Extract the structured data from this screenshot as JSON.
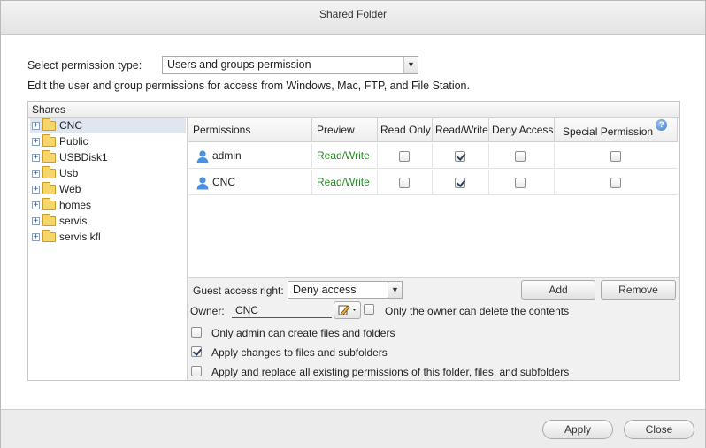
{
  "dialog": {
    "title": "Shared Folder"
  },
  "permission_type": {
    "label": "Select permission type:",
    "selected": "Users and groups permission"
  },
  "description": "Edit the user and group permissions for access from Windows, Mac, FTP, and File Station.",
  "shares": {
    "header": "Shares",
    "items": [
      {
        "label": "CNC",
        "selected": true
      },
      {
        "label": "Public"
      },
      {
        "label": "USBDisk1"
      },
      {
        "label": "Usb"
      },
      {
        "label": "Web"
      },
      {
        "label": "homes"
      },
      {
        "label": "servis"
      },
      {
        "label": "servis kfl"
      }
    ]
  },
  "grid": {
    "columns": [
      "Permissions",
      "Preview",
      "Read Only",
      "Read/Write",
      "Deny Access",
      "Special Permission"
    ],
    "rows": [
      {
        "name": "admin",
        "preview": "Read/Write",
        "read_only": false,
        "read_write": true,
        "deny": false,
        "special": false
      },
      {
        "name": "CNC",
        "preview": "Read/Write",
        "read_only": false,
        "read_write": true,
        "deny": false,
        "special": false
      }
    ]
  },
  "guest": {
    "label": "Guest access right:",
    "selected": "Deny access"
  },
  "buttons": {
    "add": "Add",
    "remove": "Remove",
    "apply": "Apply",
    "close": "Close"
  },
  "owner": {
    "label": "Owner:",
    "value": "CNC",
    "only_owner_delete_label": "Only the owner can delete the contents",
    "only_owner_delete_checked": false
  },
  "options": [
    {
      "label": "Only admin can create files and folders",
      "checked": false
    },
    {
      "label": "Apply changes to files and subfolders",
      "checked": true
    },
    {
      "label": "Apply and replace all existing permissions of this folder, files, and subfolders",
      "checked": false
    }
  ],
  "colors": {
    "preview_green": "#2a8a2a",
    "selection": "#dfe6ef",
    "accent_blue": "#3f7bc8"
  }
}
